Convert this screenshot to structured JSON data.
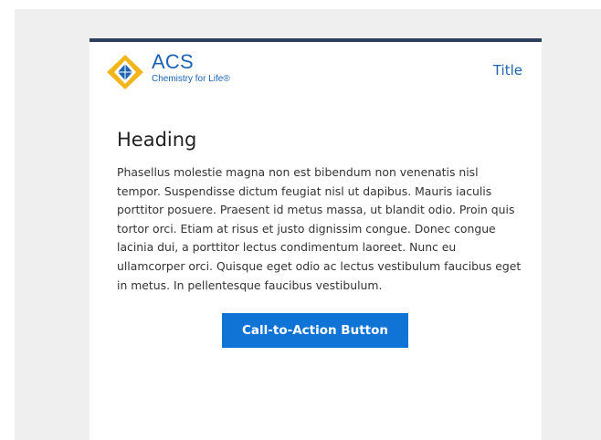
{
  "header": {
    "logo": {
      "brand": "ACS",
      "tagline": "Chemistry for Life®",
      "icon": "acs-logo-icon"
    },
    "title_link": "Title"
  },
  "content": {
    "heading": "Heading",
    "paragraph": "Phasellus molestie magna non est bibendum non venenatis nisl tempor. Suspendisse dictum feugiat nisl ut dapibus. Mauris iaculis porttitor posuere. Praesent id metus massa, ut blandit odio. Proin quis tortor orci. Etiam at risus et justo dignissim congue. Donec congue lacinia dui, a porttitor lectus condimentum laoreet. Nunc eu ullamcorper orci. Quisque eget odio ac lectus vestibulum faucibus eget in metus. In pellentesque faucibus vestibulum.",
    "cta_label": "Call-to-Action Button"
  },
  "colors": {
    "accent_bar": "#2f3e5b",
    "brand_blue": "#1d63b2",
    "button_blue": "#0f74d6",
    "logo_gold": "#f2b51c"
  }
}
